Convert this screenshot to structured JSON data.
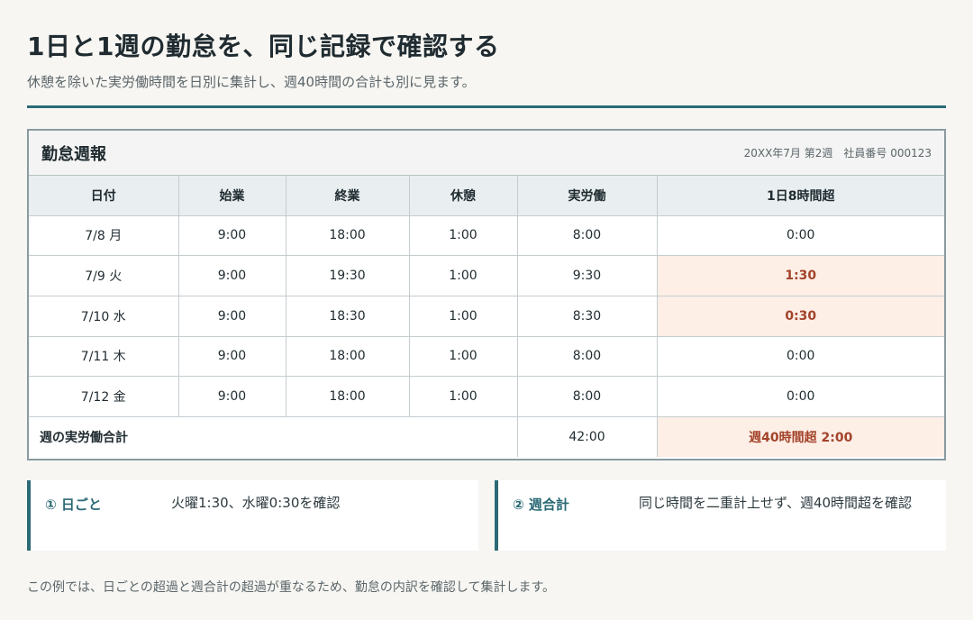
{
  "page": {
    "title": "1日と1週の勤怠を、同じ記録で確認する",
    "subtitle": "休憩を除いた実労働時間を日別に集計し、週40時間の合計も別に見ます。"
  },
  "report": {
    "title": "勤怠週報",
    "meta": "20XX年7月 第2週　社員番号 000123",
    "columns": [
      "日付",
      "始業",
      "終業",
      "休憩",
      "実労働",
      "1日8時間超"
    ],
    "rows": [
      [
        "7/8 月",
        "9:00",
        "18:00",
        "1:00",
        "8:00",
        "0:00"
      ],
      [
        "7/9 火",
        "9:00",
        "19:30",
        "1:00",
        "9:30",
        "1:30"
      ],
      [
        "7/10 水",
        "9:00",
        "18:30",
        "1:00",
        "8:30",
        "0:30"
      ],
      [
        "7/11 木",
        "9:00",
        "18:00",
        "1:00",
        "8:00",
        "0:00"
      ],
      [
        "7/12 金",
        "9:00",
        "18:00",
        "1:00",
        "8:00",
        "0:00"
      ]
    ],
    "total": {
      "label": "週の実労働合計",
      "worked": "42:00",
      "overtime": "週40時間超 2:00"
    },
    "highlight_color": "#fdeee6",
    "accent_color": "#2b6a76"
  },
  "cards": {
    "daily": {
      "label": "① 日ごと",
      "text": "火曜1:30、水曜0:30を確認"
    },
    "weekly": {
      "label": "② 週合計",
      "text": "同じ時間を二重計上せず、週40時間超を確認"
    }
  },
  "footer": {
    "note": "この例では、日ごとの超過と週合計の超過が重なるため、勤怠の内訳を確認して集計します。"
  }
}
